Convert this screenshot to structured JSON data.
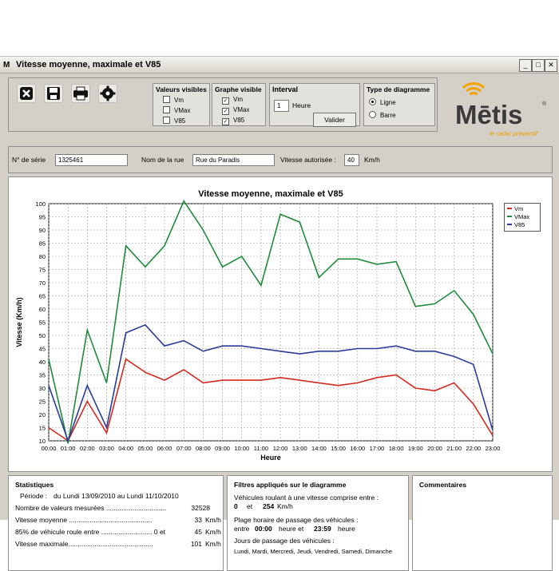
{
  "window": {
    "title": "Vitesse moyenne, maximale et V85",
    "app_icon": "M"
  },
  "toolbar": {
    "buttons": [
      "close-icon",
      "save-icon",
      "print-icon",
      "settings-icon"
    ],
    "valeurs_visibles": {
      "title": "Valeurs visibles",
      "items": [
        {
          "label": "Vm",
          "checked": false
        },
        {
          "label": "VMax",
          "checked": false
        },
        {
          "label": "V85",
          "checked": false
        }
      ]
    },
    "graphe_visible": {
      "title": "Graphe visible",
      "items": [
        {
          "label": "Vm",
          "checked": true
        },
        {
          "label": "VMax",
          "checked": true
        },
        {
          "label": "V85",
          "checked": true
        }
      ]
    },
    "interval": {
      "title": "Interval",
      "value": "1",
      "unit": "Heure",
      "button": "Valider"
    },
    "type_diagramme": {
      "title": "Type de diagramme",
      "options": [
        {
          "label": "Ligne",
          "selected": true
        },
        {
          "label": "Barre",
          "selected": false
        }
      ]
    }
  },
  "logo": {
    "name": "Mētis",
    "tagline": "le radar préventif",
    "reg": "®"
  },
  "info": {
    "serie_label": "N° de série",
    "serie_value": "1325461",
    "rue_label": "Nom de la rue",
    "rue_value": "Rue du Paradis",
    "vitesse_label": "Vitesse autorisée :",
    "vitesse_value": "40",
    "vitesse_unit": "Km/h"
  },
  "chart_data": {
    "type": "line",
    "title": "Vitesse moyenne, maximale et V85",
    "xlabel": "Heure",
    "ylabel": "Vitesse (Km/h)",
    "ylim": [
      10,
      100
    ],
    "yticks": [
      10,
      15,
      20,
      25,
      30,
      35,
      40,
      45,
      50,
      55,
      60,
      65,
      70,
      75,
      80,
      85,
      90,
      95,
      100
    ],
    "grid": true,
    "legend_position": "top-right",
    "categories": [
      "00:00",
      "01:00",
      "02:00",
      "03:00",
      "04:00",
      "05:00",
      "06:00",
      "07:00",
      "08:00",
      "09:00",
      "10:00",
      "11:00",
      "12:00",
      "13:00",
      "14:00",
      "15:00",
      "16:00",
      "17:00",
      "18:00",
      "19:00",
      "20:00",
      "21:00",
      "22:00",
      "23:00"
    ],
    "series": [
      {
        "name": "Vm",
        "color": "#d42a1e",
        "values": [
          15,
          10,
          25,
          13,
          41,
          36,
          33,
          37,
          32,
          33,
          33,
          33,
          34,
          33,
          32,
          31,
          32,
          34,
          35,
          30,
          29,
          32,
          24,
          12
        ]
      },
      {
        "name": "VMax",
        "color": "#1f8a3a",
        "values": [
          41,
          9,
          52,
          32,
          84,
          76,
          84,
          101,
          90,
          76,
          80,
          69,
          96,
          93,
          72,
          79,
          79,
          77,
          78,
          61,
          62,
          67,
          58,
          43
        ]
      },
      {
        "name": "V85",
        "color": "#2a3b9a",
        "values": [
          31,
          10,
          31,
          15,
          51,
          54,
          46,
          48,
          44,
          46,
          46,
          45,
          44,
          43,
          44,
          44,
          45,
          45,
          46,
          44,
          44,
          42,
          39,
          14
        ]
      }
    ]
  },
  "stats": {
    "title": "Statistiques",
    "periode_label": "Période :",
    "periode_value": "du Lundi 13/09/2010 au Lundi 11/10/2010",
    "rows": [
      {
        "label": "Nombre de valeurs mesurées ................................",
        "value": "32528",
        "unit": ""
      },
      {
        "label": "Vitesse moyenne ............................................",
        "value": "33",
        "unit": "Km/h"
      },
      {
        "label": "85% de véhicule roule entre ........................... 0 et",
        "value": "45",
        "unit": "Km/h"
      },
      {
        "label": "Vitesse maximale.............................................",
        "value": "101",
        "unit": "Km/h"
      }
    ]
  },
  "filters": {
    "title": "Filtres appliqués sur le diagramme",
    "line1": "Véhicules roulant à une vitesse comprise entre :",
    "v_min": "0",
    "et": "et",
    "v_max": "254",
    "v_unit": "Km/h",
    "line2": "Plage horaire de passage des véhicules :",
    "entre": "entre",
    "h_start": "00:00",
    "heure_et": "heure et",
    "h_end": "23:59",
    "heure": "heure",
    "line3": "Jours de passage des véhicules :",
    "jours": "Lundi, Mardi, Mercredi, Jeudi, Vendredi, Samedi, Dimanche"
  },
  "comments": {
    "title": "Commentaires"
  }
}
